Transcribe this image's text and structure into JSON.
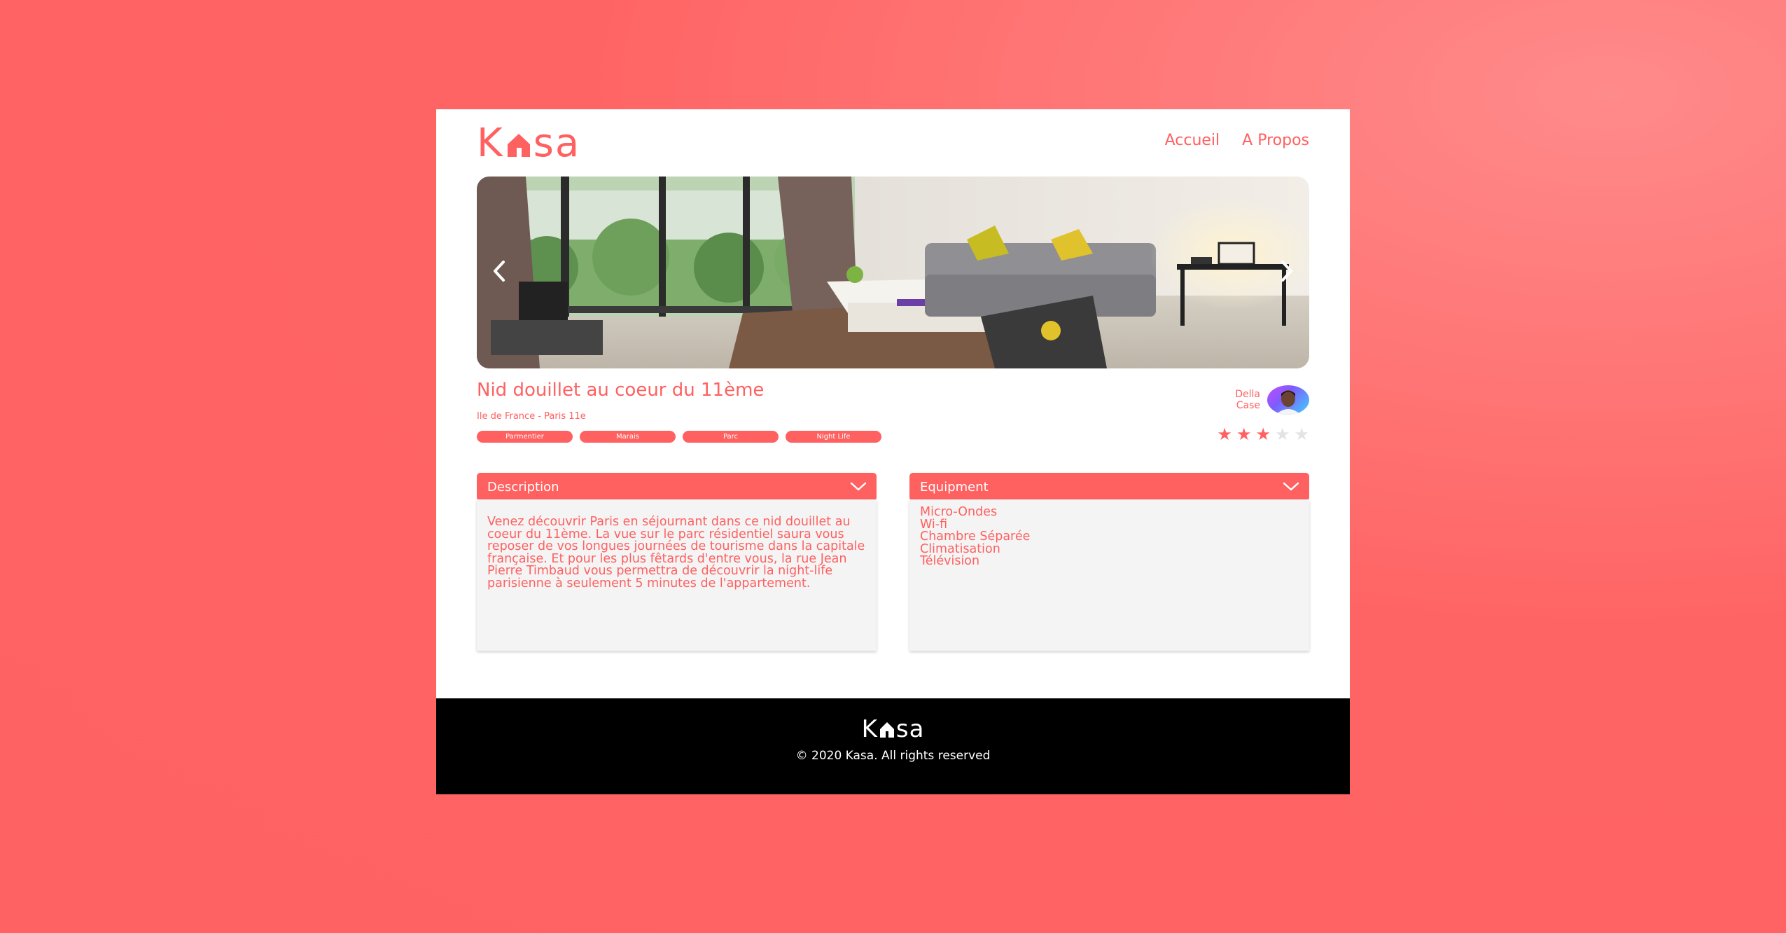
{
  "header": {
    "logo_prefix": "K",
    "logo_suffix": "sa",
    "nav": [
      {
        "label": "Accueil"
      },
      {
        "label": "A Propos"
      }
    ]
  },
  "gallery": {
    "prev_icon": "chevron-left-icon",
    "next_icon": "chevron-right-icon"
  },
  "listing": {
    "title": "Nid douillet au coeur du 11ème",
    "location": "Ile de France - Paris 11e",
    "tags": [
      "Parmentier",
      "Marais",
      "Parc",
      "Night Life"
    ],
    "host": {
      "first_name": "Della",
      "last_name": "Case"
    },
    "rating": 3,
    "rating_max": 5
  },
  "description": {
    "header": "Description",
    "body": "Venez découvrir Paris en séjournant dans ce nid douillet au coeur du 11ème. La vue sur le parc résidentiel saura vous reposer de vos longues journées de tourisme dans la capitale française. Et pour les plus fêtards d'entre vous, la rue Jean Pierre Timbaud vous permettra de découvrir la night-life parisienne à seulement 5 minutes de l'appartement."
  },
  "equipment": {
    "header": "Equipment",
    "items": [
      "Micro-Ondes",
      "Wi-fi",
      "Chambre Séparée",
      "Climatisation",
      "Télévision"
    ]
  },
  "footer": {
    "logo_prefix": "K",
    "logo_suffix": "sa",
    "copyright": "© 2020 Kasa. All rights reserved"
  },
  "colors": {
    "accent": "#ff6060",
    "background": "#ff6464",
    "star_off": "#e3e3e3",
    "panel": "#f4f4f4"
  }
}
